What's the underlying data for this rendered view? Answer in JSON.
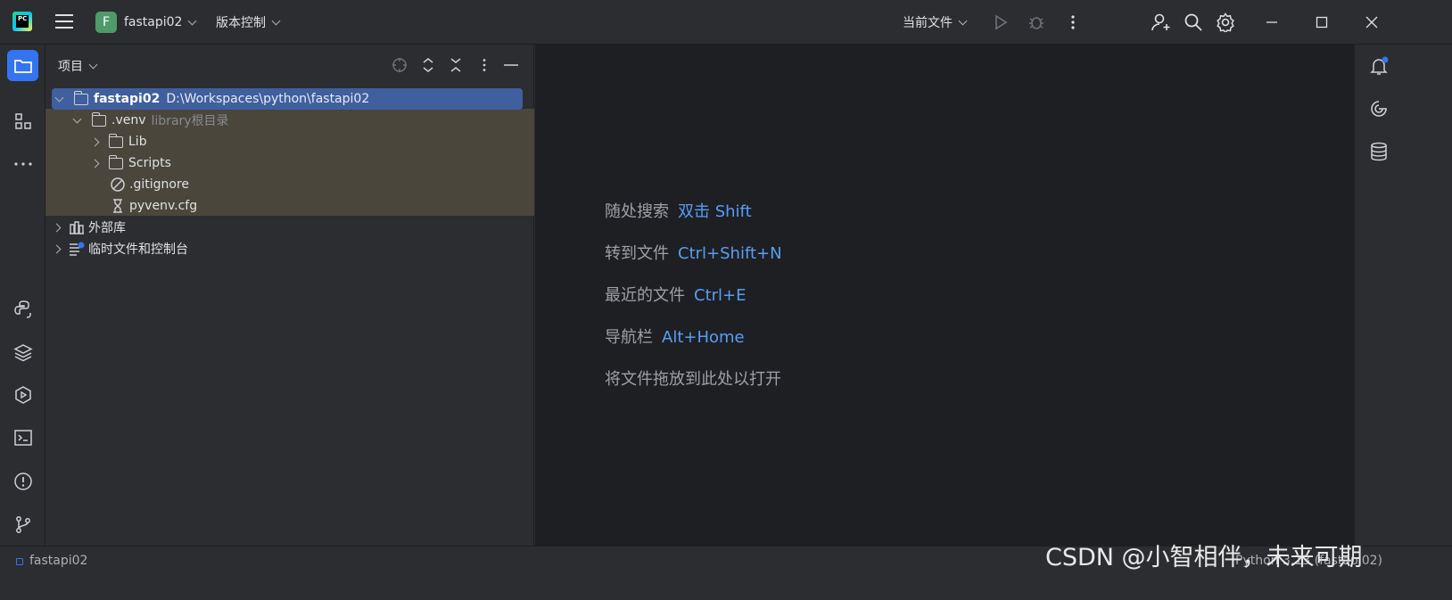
{
  "titlebar": {
    "project_badge": "F",
    "project_name": "fastapi02",
    "vcs_label": "版本控制",
    "run_config": "当前文件",
    "icons": [
      "pycharm-logo-icon",
      "hamburger-menu-icon",
      "run-icon",
      "debug-icon",
      "more-vertical-icon",
      "add-user-icon",
      "search-icon",
      "settings-gear-icon",
      "minimize-icon",
      "maximize-icon",
      "close-icon"
    ]
  },
  "left_toolbar": {
    "icons": [
      "project-folder-icon",
      "structure-icon",
      "more-horizontal-icon",
      "python-console-icon",
      "layers-icon",
      "services-icon",
      "terminal-icon",
      "problems-icon",
      "git-branch-icon"
    ]
  },
  "right_toolbar": {
    "icons": [
      "notifications-bell-icon",
      "ai-assistant-icon",
      "database-icon"
    ]
  },
  "project_panel": {
    "title": "项目",
    "tree": [
      {
        "label": "fastapi02",
        "detail": "D:\\Workspaces\\python\\fastapi02"
      },
      {
        "label": ".venv",
        "detail": "library根目录"
      },
      {
        "label": "Lib"
      },
      {
        "label": "Scripts"
      },
      {
        "label": ".gitignore"
      },
      {
        "label": "pyvenv.cfg"
      },
      {
        "label": "外部库"
      },
      {
        "label": "临时文件和控制台"
      }
    ]
  },
  "editor": {
    "hints": [
      {
        "label": "随处搜索",
        "key": "双击 Shift"
      },
      {
        "label": "转到文件",
        "key": "Ctrl+Shift+N"
      },
      {
        "label": "最近的文件",
        "key": "Ctrl+E"
      },
      {
        "label": "导航栏",
        "key": "Alt+Home"
      },
      {
        "label": "将文件拖放到此处以打开",
        "key": ""
      }
    ]
  },
  "statusbar": {
    "project": "fastapi02",
    "interpreter": "Python 3.13 (fastapi02)"
  },
  "watermark": "CSDN @小智相伴，未来可期"
}
